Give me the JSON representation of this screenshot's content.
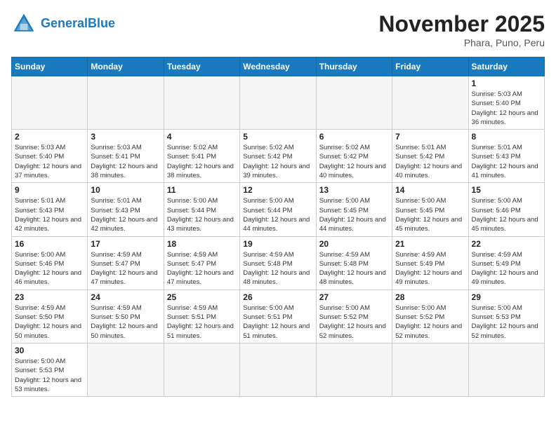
{
  "header": {
    "logo_general": "General",
    "logo_blue": "Blue",
    "month_title": "November 2025",
    "subtitle": "Phara, Puno, Peru"
  },
  "weekdays": [
    "Sunday",
    "Monday",
    "Tuesday",
    "Wednesday",
    "Thursday",
    "Friday",
    "Saturday"
  ],
  "weeks": [
    [
      {
        "day": "",
        "info": ""
      },
      {
        "day": "",
        "info": ""
      },
      {
        "day": "",
        "info": ""
      },
      {
        "day": "",
        "info": ""
      },
      {
        "day": "",
        "info": ""
      },
      {
        "day": "",
        "info": ""
      },
      {
        "day": "1",
        "info": "Sunrise: 5:03 AM\nSunset: 5:40 PM\nDaylight: 12 hours\nand 36 minutes."
      }
    ],
    [
      {
        "day": "2",
        "info": "Sunrise: 5:03 AM\nSunset: 5:40 PM\nDaylight: 12 hours\nand 37 minutes."
      },
      {
        "day": "3",
        "info": "Sunrise: 5:03 AM\nSunset: 5:41 PM\nDaylight: 12 hours\nand 38 minutes."
      },
      {
        "day": "4",
        "info": "Sunrise: 5:02 AM\nSunset: 5:41 PM\nDaylight: 12 hours\nand 38 minutes."
      },
      {
        "day": "5",
        "info": "Sunrise: 5:02 AM\nSunset: 5:42 PM\nDaylight: 12 hours\nand 39 minutes."
      },
      {
        "day": "6",
        "info": "Sunrise: 5:02 AM\nSunset: 5:42 PM\nDaylight: 12 hours\nand 40 minutes."
      },
      {
        "day": "7",
        "info": "Sunrise: 5:01 AM\nSunset: 5:42 PM\nDaylight: 12 hours\nand 40 minutes."
      },
      {
        "day": "8",
        "info": "Sunrise: 5:01 AM\nSunset: 5:43 PM\nDaylight: 12 hours\nand 41 minutes."
      }
    ],
    [
      {
        "day": "9",
        "info": "Sunrise: 5:01 AM\nSunset: 5:43 PM\nDaylight: 12 hours\nand 42 minutes."
      },
      {
        "day": "10",
        "info": "Sunrise: 5:01 AM\nSunset: 5:43 PM\nDaylight: 12 hours\nand 42 minutes."
      },
      {
        "day": "11",
        "info": "Sunrise: 5:00 AM\nSunset: 5:44 PM\nDaylight: 12 hours\nand 43 minutes."
      },
      {
        "day": "12",
        "info": "Sunrise: 5:00 AM\nSunset: 5:44 PM\nDaylight: 12 hours\nand 44 minutes."
      },
      {
        "day": "13",
        "info": "Sunrise: 5:00 AM\nSunset: 5:45 PM\nDaylight: 12 hours\nand 44 minutes."
      },
      {
        "day": "14",
        "info": "Sunrise: 5:00 AM\nSunset: 5:45 PM\nDaylight: 12 hours\nand 45 minutes."
      },
      {
        "day": "15",
        "info": "Sunrise: 5:00 AM\nSunset: 5:46 PM\nDaylight: 12 hours\nand 45 minutes."
      }
    ],
    [
      {
        "day": "16",
        "info": "Sunrise: 5:00 AM\nSunset: 5:46 PM\nDaylight: 12 hours\nand 46 minutes."
      },
      {
        "day": "17",
        "info": "Sunrise: 4:59 AM\nSunset: 5:47 PM\nDaylight: 12 hours\nand 47 minutes."
      },
      {
        "day": "18",
        "info": "Sunrise: 4:59 AM\nSunset: 5:47 PM\nDaylight: 12 hours\nand 47 minutes."
      },
      {
        "day": "19",
        "info": "Sunrise: 4:59 AM\nSunset: 5:48 PM\nDaylight: 12 hours\nand 48 minutes."
      },
      {
        "day": "20",
        "info": "Sunrise: 4:59 AM\nSunset: 5:48 PM\nDaylight: 12 hours\nand 48 minutes."
      },
      {
        "day": "21",
        "info": "Sunrise: 4:59 AM\nSunset: 5:49 PM\nDaylight: 12 hours\nand 49 minutes."
      },
      {
        "day": "22",
        "info": "Sunrise: 4:59 AM\nSunset: 5:49 PM\nDaylight: 12 hours\nand 49 minutes."
      }
    ],
    [
      {
        "day": "23",
        "info": "Sunrise: 4:59 AM\nSunset: 5:50 PM\nDaylight: 12 hours\nand 50 minutes."
      },
      {
        "day": "24",
        "info": "Sunrise: 4:59 AM\nSunset: 5:50 PM\nDaylight: 12 hours\nand 50 minutes."
      },
      {
        "day": "25",
        "info": "Sunrise: 4:59 AM\nSunset: 5:51 PM\nDaylight: 12 hours\nand 51 minutes."
      },
      {
        "day": "26",
        "info": "Sunrise: 5:00 AM\nSunset: 5:51 PM\nDaylight: 12 hours\nand 51 minutes."
      },
      {
        "day": "27",
        "info": "Sunrise: 5:00 AM\nSunset: 5:52 PM\nDaylight: 12 hours\nand 52 minutes."
      },
      {
        "day": "28",
        "info": "Sunrise: 5:00 AM\nSunset: 5:52 PM\nDaylight: 12 hours\nand 52 minutes."
      },
      {
        "day": "29",
        "info": "Sunrise: 5:00 AM\nSunset: 5:53 PM\nDaylight: 12 hours\nand 52 minutes."
      }
    ],
    [
      {
        "day": "30",
        "info": "Sunrise: 5:00 AM\nSunset: 5:53 PM\nDaylight: 12 hours\nand 53 minutes."
      },
      {
        "day": "",
        "info": ""
      },
      {
        "day": "",
        "info": ""
      },
      {
        "day": "",
        "info": ""
      },
      {
        "day": "",
        "info": ""
      },
      {
        "day": "",
        "info": ""
      },
      {
        "day": "",
        "info": ""
      }
    ]
  ]
}
